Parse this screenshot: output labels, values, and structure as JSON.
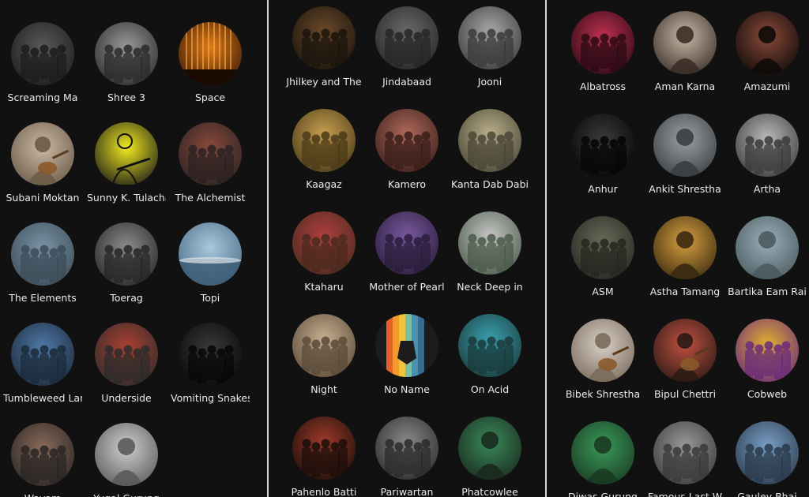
{
  "panels": [
    {
      "artists": [
        {
          "name": "Screaming Ma",
          "icon": "band-photo",
          "colors": [
            "#5a5a5a",
            "#1c1c1c"
          ]
        },
        {
          "name": "Shree 3",
          "icon": "band-photo",
          "colors": [
            "#9a9a9a",
            "#2a2a2a"
          ]
        },
        {
          "name": "Space",
          "icon": "stage-lights-photo",
          "colors": [
            "#e07a1a",
            "#3a1a05"
          ]
        },
        {
          "name": "Subani Moktan",
          "icon": "portrait-guitar-photo",
          "colors": [
            "#c9b9a4",
            "#6b5a48"
          ]
        },
        {
          "name": "Sunny K. Tulachan",
          "icon": "guitarist-yellow-photo",
          "colors": [
            "#f2ea1e",
            "#1a1a1a"
          ]
        },
        {
          "name": "The Alchemist",
          "icon": "band-photo",
          "colors": [
            "#8a4a3a",
            "#2a2222"
          ]
        },
        {
          "name": "The Elements",
          "icon": "band-photo",
          "colors": [
            "#7a94a6",
            "#3c4c58"
          ]
        },
        {
          "name": "Toerag",
          "icon": "band-photo",
          "colors": [
            "#8d8d8d",
            "#262626"
          ]
        },
        {
          "name": "Topi",
          "icon": "sky-photo",
          "colors": [
            "#a8c8dc",
            "#4a6c86"
          ]
        },
        {
          "name": "Tumbleweed Lane",
          "icon": "band-photo",
          "colors": [
            "#4f7aa8",
            "#1c2a3a"
          ]
        },
        {
          "name": "Underside",
          "icon": "band-photo",
          "colors": [
            "#b04030",
            "#2b2b2b"
          ]
        },
        {
          "name": "Vomiting Snakes",
          "icon": "band-photo",
          "colors": [
            "#3a3a3a",
            "#070707"
          ]
        },
        {
          "name": "Wayam",
          "icon": "band-photo",
          "colors": [
            "#8a6a5a",
            "#2a2624"
          ]
        },
        {
          "name": "Yugal Gurung",
          "icon": "portrait-photo",
          "colors": [
            "#cfcfcf",
            "#5a5a5a"
          ]
        }
      ]
    },
    {
      "artists": [
        {
          "name": "Jhilkey and The",
          "icon": "band-photo",
          "colors": [
            "#6b4a2a",
            "#1a140c"
          ]
        },
        {
          "name": "Jindabaad",
          "icon": "band-photo",
          "colors": [
            "#6a6a6a",
            "#262626"
          ]
        },
        {
          "name": "Jooni",
          "icon": "band-photo",
          "colors": [
            "#a8a8a8",
            "#3a3a3a"
          ]
        },
        {
          "name": "Kaagaz",
          "icon": "band-photo",
          "colors": [
            "#c8a050",
            "#4a3a18"
          ]
        },
        {
          "name": "Kamero",
          "icon": "band-photo",
          "colors": [
            "#b06a5a",
            "#3a1e1a"
          ]
        },
        {
          "name": "Kanta Dab Dabi",
          "icon": "band-photo",
          "colors": [
            "#b9b08a",
            "#4a4636"
          ]
        },
        {
          "name": "Ktaharu",
          "icon": "band-photo",
          "colors": [
            "#b04040",
            "#4a2a1e"
          ]
        },
        {
          "name": "Mother of Pearl",
          "icon": "band-photo",
          "colors": [
            "#7a5aa0",
            "#2a1c3a"
          ]
        },
        {
          "name": "Neck Deep in",
          "icon": "band-photo",
          "colors": [
            "#c8c8c8",
            "#4a5a4a"
          ]
        },
        {
          "name": "Night",
          "icon": "band-photo",
          "colors": [
            "#c8b090",
            "#5a4a38"
          ]
        },
        {
          "name": "No Name",
          "icon": "no-name-logo",
          "colors": [
            "#e4622a",
            "#1a1a1a"
          ]
        },
        {
          "name": "On Acid",
          "icon": "band-photo",
          "colors": [
            "#3aa0b0",
            "#1a3a3a"
          ]
        },
        {
          "name": "Pahenlo Batti",
          "icon": "band-photo",
          "colors": [
            "#a03a2a",
            "#1a0e0a"
          ]
        },
        {
          "name": "Pariwartan",
          "icon": "band-photo",
          "colors": [
            "#8a8a8a",
            "#2a2a2a"
          ]
        },
        {
          "name": "Phatcowlee",
          "icon": "portrait-photo",
          "colors": [
            "#3a8a5a",
            "#1a2a1e"
          ]
        }
      ]
    },
    {
      "artists": [
        {
          "name": "Albatross",
          "icon": "band-photo",
          "colors": [
            "#c03050",
            "#2a0a14"
          ]
        },
        {
          "name": "Aman Karna",
          "icon": "portrait-photo",
          "colors": [
            "#c8b8a8",
            "#3a2e26"
          ]
        },
        {
          "name": "Amazumi",
          "icon": "portrait-photo",
          "colors": [
            "#8a4a3a",
            "#0e0a08"
          ]
        },
        {
          "name": "Anhur",
          "icon": "band-photo",
          "colors": [
            "#3a3a3a",
            "#050505"
          ]
        },
        {
          "name": "Ankit Shrestha",
          "icon": "portrait-photo",
          "colors": [
            "#9aa0a6",
            "#3a3e42"
          ]
        },
        {
          "name": "Artha",
          "icon": "band-photo",
          "colors": [
            "#bcbcbc",
            "#3a3a3a"
          ]
        },
        {
          "name": "ASM",
          "icon": "band-photo",
          "colors": [
            "#6a6a5a",
            "#262620"
          ]
        },
        {
          "name": "Astha Tamang",
          "icon": "portrait-photo",
          "colors": [
            "#d8a040",
            "#3a2a10"
          ]
        },
        {
          "name": "Bartika Eam Rai",
          "icon": "portrait-water-photo",
          "colors": [
            "#9ab0b8",
            "#4a5a60"
          ]
        },
        {
          "name": "Bibek Shrestha",
          "icon": "portrait-guitar-photo",
          "colors": [
            "#d8d0c8",
            "#7a6a5a"
          ]
        },
        {
          "name": "Bipul Chettri",
          "icon": "portrait-guitar-photo",
          "colors": [
            "#c05040",
            "#2a1a14"
          ]
        },
        {
          "name": "Cobweb",
          "icon": "band-photo",
          "colors": [
            "#e0b030",
            "#6a2a7a"
          ]
        },
        {
          "name": "Diwas Gurung",
          "icon": "portrait-photo",
          "colors": [
            "#3a9a5a",
            "#1a3a22"
          ]
        },
        {
          "name": "Famous Last W",
          "icon": "band-photo",
          "colors": [
            "#9a9a9a",
            "#3a3a3a"
          ]
        },
        {
          "name": "Gauley Bhai",
          "icon": "band-photo",
          "colors": [
            "#7aa0c8",
            "#2a3a4a"
          ]
        }
      ]
    }
  ]
}
